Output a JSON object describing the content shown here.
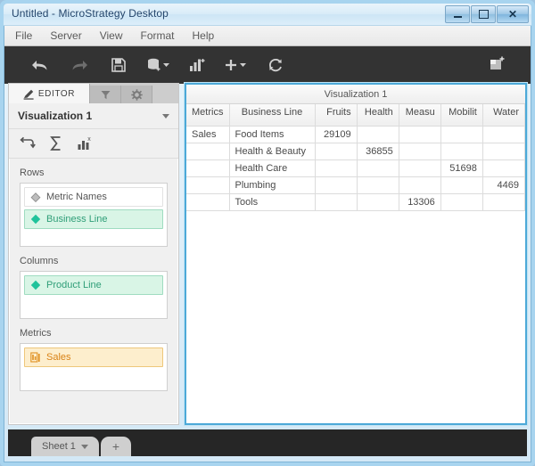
{
  "window": {
    "title": "Untitled - MicroStrategy Desktop",
    "controls": [
      {
        "name": "minimize",
        "label": "—"
      },
      {
        "name": "maximize",
        "label": "□"
      },
      {
        "name": "close",
        "label": "X"
      }
    ]
  },
  "menubar": {
    "items": [
      "File",
      "Server",
      "View",
      "Format",
      "Help"
    ]
  },
  "toolbar": {
    "items": [
      {
        "name": "undo-icon",
        "label": "Undo",
        "enabled": true
      },
      {
        "name": "redo-icon",
        "label": "Redo",
        "enabled": false
      },
      {
        "name": "save-icon",
        "label": "Save",
        "enabled": true
      },
      {
        "name": "add-data-icon",
        "label": "Add Data",
        "enabled": true
      },
      {
        "name": "add-visualization-icon",
        "label": "Add Visualization",
        "enabled": true
      },
      {
        "name": "insert-icon",
        "label": "Insert",
        "enabled": true
      },
      {
        "name": "refresh-icon",
        "label": "Refresh",
        "enabled": true
      }
    ],
    "right_item": {
      "name": "new-panel-icon",
      "label": "New Panel"
    }
  },
  "editor": {
    "tabs": [
      {
        "name": "editor",
        "label": "EDITOR",
        "icon": "pencil-icon",
        "active": true
      },
      {
        "name": "filters",
        "label": "",
        "icon": "filter-icon",
        "active": false
      },
      {
        "name": "settings",
        "label": "",
        "icon": "gear-icon",
        "active": false
      }
    ],
    "visualization_name": "Visualization 1",
    "mini_tools": [
      {
        "name": "swap-rows-columns-icon",
        "label": "Swap Rows/Columns"
      },
      {
        "name": "totals-icon",
        "label": "Totals"
      },
      {
        "name": "visualization-type-icon",
        "label": "Visualization Type"
      }
    ],
    "zones": [
      {
        "name": "rows",
        "label": "Rows",
        "chips": [
          {
            "label": "Metric Names",
            "type": "plain",
            "icon": "tag-icon"
          },
          {
            "label": "Business Line",
            "type": "attribute",
            "icon": "attribute-diamond-icon"
          }
        ]
      },
      {
        "name": "columns",
        "label": "Columns",
        "chips": [
          {
            "label": "Product Line",
            "type": "attribute",
            "icon": "attribute-diamond-icon"
          }
        ]
      },
      {
        "name": "metrics",
        "label": "Metrics",
        "chips": [
          {
            "label": "Sales",
            "type": "metric",
            "icon": "metric-bar-icon"
          }
        ]
      }
    ]
  },
  "visualization": {
    "title": "Visualization 1",
    "grid": {
      "headers": [
        "Metrics",
        "Business Line",
        "Fruits",
        "Health",
        "Measu",
        "Mobilit",
        "Water"
      ],
      "rows": [
        {
          "metric": "Sales",
          "business_line": "Food Items",
          "values": [
            "29109",
            "",
            "",
            "",
            ""
          ]
        },
        {
          "metric": "",
          "business_line": "Health & Beauty",
          "values": [
            "",
            "36855",
            "",
            "",
            ""
          ]
        },
        {
          "metric": "",
          "business_line": "Health Care",
          "values": [
            "",
            "",
            "",
            "51698",
            ""
          ]
        },
        {
          "metric": "",
          "business_line": "Plumbing",
          "values": [
            "",
            "",
            "",
            "",
            "4469"
          ]
        },
        {
          "metric": "",
          "business_line": "Tools",
          "values": [
            "",
            "",
            "13306",
            "",
            ""
          ]
        }
      ]
    }
  },
  "sheetbar": {
    "tabs": [
      {
        "name": "sheet-1",
        "label": "Sheet 1"
      }
    ],
    "add_label": "+"
  },
  "colors": {
    "titlebar": "#d9ecf8",
    "toolbar": "#333333",
    "accent_blue": "#4ca9d8",
    "attribute_green": "#2f9e78",
    "metric_orange": "#d98216",
    "panel_grey": "#f0f0f0"
  }
}
